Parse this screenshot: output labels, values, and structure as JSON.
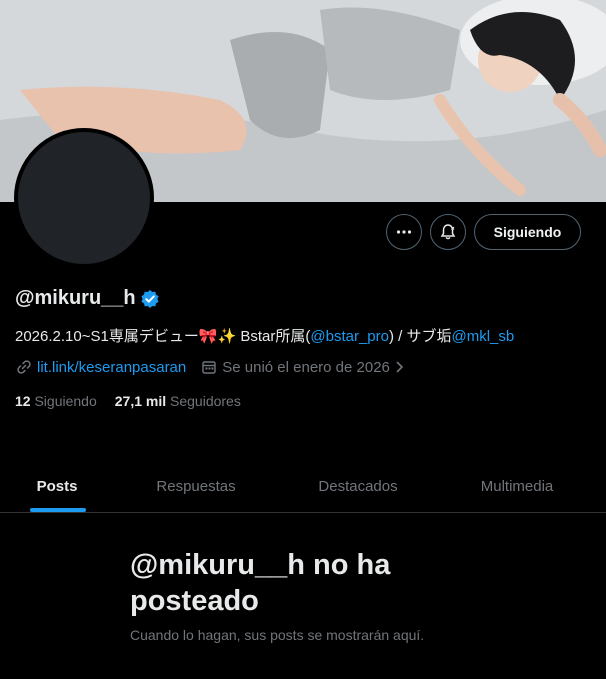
{
  "profile": {
    "handle": "@mikuru__h",
    "bio_prefix": "2026.2.10~S1専属デビュー🎀✨ Bstar所属(",
    "bio_mention1": "@bstar_pro",
    "bio_middle": ") / サブ垢",
    "bio_mention2": "@mkl_sb",
    "website": "lit.link/keseranpasaran",
    "joined": "Se unió el enero de 2026",
    "following_count": "12",
    "following_label": "Siguiendo",
    "followers_count": "27,1 mil",
    "followers_label": "Seguidores"
  },
  "actions": {
    "more_icon": "more-icon",
    "notify_icon": "bell-icon",
    "follow_label": "Siguiendo"
  },
  "tabs": [
    {
      "label": "Posts",
      "active": true
    },
    {
      "label": "Respuestas",
      "active": false
    },
    {
      "label": "Destacados",
      "active": false
    },
    {
      "label": "Multimedia",
      "active": false
    }
  ],
  "empty_state": {
    "title": "@mikuru__h no ha posteado",
    "subtitle": "Cuando lo hagan, sus posts se mostrarán aquí."
  },
  "colors": {
    "accent": "#1d9bf0",
    "background": "#000000",
    "muted": "#71767b"
  }
}
